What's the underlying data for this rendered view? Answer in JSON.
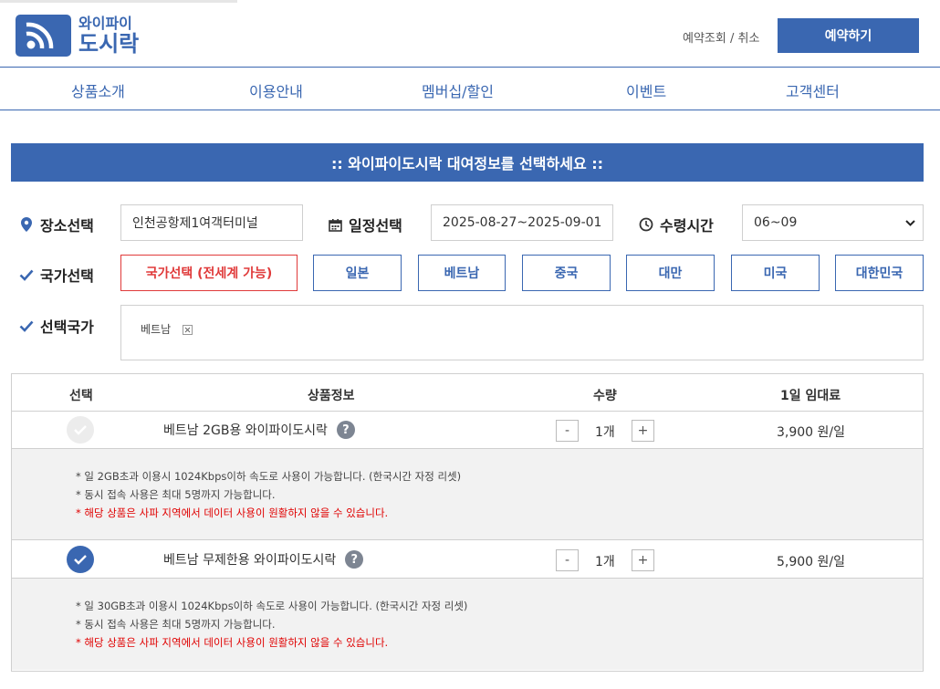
{
  "header": {
    "logo_top": "와이파이",
    "logo_bottom": "도시락",
    "lookup_link": "예약조회 / 취소",
    "reserve_button": "예약하기"
  },
  "nav": [
    "상품소개",
    "이용안내",
    "멤버십/할인",
    "이벤트",
    "고객센터"
  ],
  "banner": ":: 와이파이도시락 대여정보를 선택하세요 ::",
  "form": {
    "place_label": "장소선택",
    "place_value": "인천공항제1여객터미널",
    "date_label": "일정선택",
    "date_value": "2025-08-27~2025-09-01",
    "time_label": "수령시간",
    "time_value": "06~09",
    "country_label": "국가선택",
    "countries": [
      "국가선택 (전세계 가능)",
      "일본",
      "베트남",
      "중국",
      "대만",
      "미국",
      "대한민국"
    ],
    "selected_label": "선택국가",
    "selected_tag": "베트남"
  },
  "table": {
    "headers": [
      "선택",
      "상품정보",
      "수량",
      "1일 임대료"
    ],
    "rows": [
      {
        "name": "베트남 2GB용 와이파이도시락",
        "qmark": "?",
        "minus": "-",
        "qty": "1개",
        "plus": "+",
        "price": "3,900 원/일",
        "checked": false,
        "notes": [
          "* 일 2GB초과 이용시 1024Kbps이하 속도로 사용이 가능합니다. (한국시간 자정 리셋)",
          "* 동시 접속 사용은 최대 5명까지 가능합니다.",
          "* 해당 상품은 사파 지역에서 데이터 사용이 원활하지 않을 수 있습니다."
        ]
      },
      {
        "name": "베트남 무제한용 와이파이도시락",
        "qmark": "?",
        "minus": "-",
        "qty": "1개",
        "plus": "+",
        "price": "5,900 원/일",
        "checked": true,
        "notes": [
          "* 일 30GB초과 이용시 1024Kbps이하 속도로 사용이 가능합니다. (한국시간 자정 리셋)",
          "* 동시 접속 사용은 최대 5명까지 가능합니다.",
          "* 해당 상품은 사파 지역에서 데이터 사용이 원활하지 않을 수 있습니다."
        ]
      }
    ]
  },
  "colors": {
    "brand_blue": "#3a67b1",
    "alert_red": "#e00000"
  }
}
